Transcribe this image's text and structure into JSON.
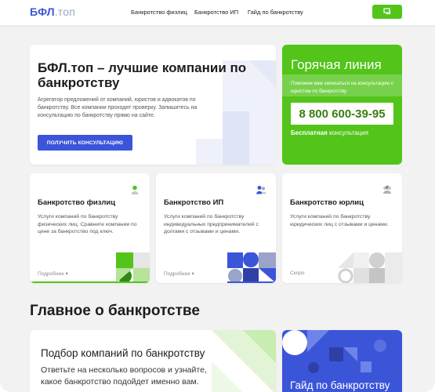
{
  "header": {
    "logo_main": "БФЛ",
    "logo_suffix": ".топ",
    "nav": [
      "Банкротство физлиц",
      "Банкротство ИП",
      "Гайд по банкротству"
    ],
    "chat_icon": "chat-icon"
  },
  "hero": {
    "title": "БФЛ.топ – лучшие компании по банкротству",
    "description": "Агрегатор предложений от компаний, юристов и адвокатов по банкротству. Все компании проходят проверку. Запишитесь на консультацию по банкротству прямо на сайте.",
    "cta": "ПОЛУЧИТЬ КОНСУЛЬТАЦИЮ"
  },
  "hotline": {
    "title": "Горячая линия",
    "subtitle": "Поможем вам записаться на консультацию с юристом по банкротству",
    "phone": "8 800 600-39-95",
    "free_bold": "Бесплатная",
    "free_rest": " консультация"
  },
  "services": [
    {
      "title": "Банкротство физлиц",
      "description": "Услуги компаний по банкротству физических лиц. Сравните компании по цене за банкротство под ключ.",
      "more": "Подробнее",
      "icon": "person-icon"
    },
    {
      "title": "Банкротство ИП",
      "description": "Услуги компаний по банкротству индивидуальных предпринимателей с долгами с отзывами и ценами.",
      "more": "Подробнее",
      "icon": "people-icon"
    },
    {
      "title": "Банкротство юрлиц",
      "description": "Услуги компаний по банкротству юридических лиц с отзывами и ценами.",
      "more": "Скоро",
      "icon": "group-icon"
    }
  ],
  "main_section": {
    "title": "Главное о банкротстве",
    "pick": {
      "title": "Подбор компаний по банкротству",
      "description": "Ответьте на несколько вопросов и узнайте, какое банкротство подойдет именно вам."
    },
    "guide": {
      "title": "Гайд по банкротству"
    }
  },
  "colors": {
    "accent_blue": "#3b55d9",
    "accent_green": "#52c41a"
  }
}
